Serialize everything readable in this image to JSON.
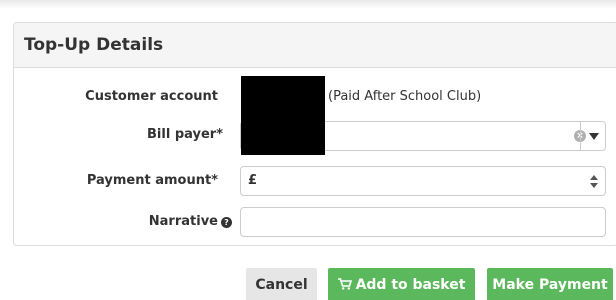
{
  "panel": {
    "title": "Top-Up Details"
  },
  "form": {
    "customer_account": {
      "label": "Customer account",
      "value_suffix": "(Paid After School Club)"
    },
    "bill_payer": {
      "label": "Bill payer*",
      "clear_glyph": "×"
    },
    "payment_amount": {
      "label": "Payment amount*",
      "currency_symbol": "£",
      "value": ""
    },
    "narrative": {
      "label": "Narrative",
      "help_glyph": "?",
      "value": ""
    }
  },
  "buttons": {
    "cancel": "Cancel",
    "add_to_basket": "Add to basket",
    "make_payment": "Make Payment"
  },
  "icons": {
    "cart": "shopping-cart-icon",
    "clear": "clear-icon",
    "dropdown": "chevron-down-icon",
    "help": "help-icon",
    "spinner": "number-spinner-icon"
  },
  "colors": {
    "primary_green": "#5cb85c",
    "cancel_gray": "#e6e6e6",
    "heading_bg": "#f5f5f5"
  }
}
